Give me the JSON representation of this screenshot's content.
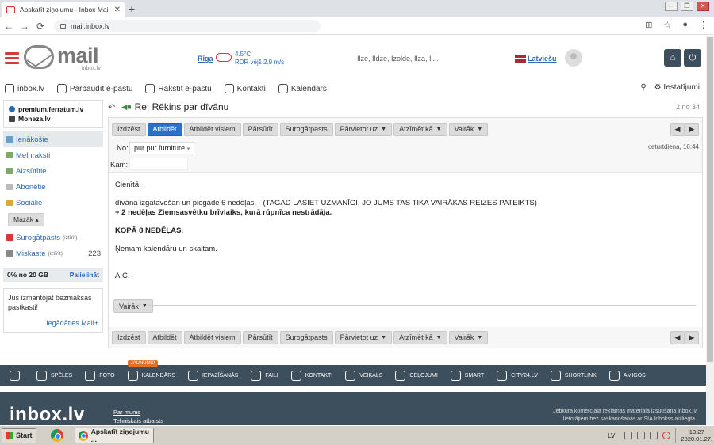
{
  "browser": {
    "tab_title": "Apskatīt ziņojumu - Inbox Mail",
    "tab_close": "✕",
    "new_tab": "+",
    "url": "mail.inbox.lv",
    "win_controls": [
      "—",
      "❐",
      "✕"
    ],
    "nav_back": "←",
    "nav_forward": "→",
    "nav_reload": "⟳"
  },
  "header": {
    "logo_text": "mail",
    "logo_sub": "inbox.lv",
    "weather_city": "Rīga",
    "weather_temp": "4.5°C",
    "weather_wind": "RDR vējš 2.9 m/s",
    "namedays": "Ilze, Ildze, Izolde, Ilza, Il...",
    "language": "Latviešu"
  },
  "linkbar": {
    "items": [
      "inbox.lv",
      "Pārbaudīt e-pastu",
      "Rakstīt e-pastu",
      "Kontakti",
      "Kalendārs"
    ],
    "settings": "Iestatījumi"
  },
  "sidebar": {
    "services": [
      "premium.ferratum.lv",
      "Moneza.lv"
    ],
    "folders": [
      {
        "label": "Ienākošie",
        "active": true
      },
      {
        "label": "Melnraksti"
      },
      {
        "label": "Aizsūtītie"
      },
      {
        "label": "Abonētie"
      },
      {
        "label": "Sociālie"
      }
    ],
    "less": "Mazāk ▴",
    "spam": {
      "label": "Surogātpasts",
      "note": "(iztīrīt)"
    },
    "trash": {
      "label": "Miskaste",
      "note": "(iztīrīt)",
      "count": "223"
    },
    "quota": "0% no 20 GB",
    "upgrade": "Palielināt",
    "promo_text": "Jūs izmantojat bezmaksas pastkasti!",
    "promo_link": "Iegādāties Mail+"
  },
  "message": {
    "subject": "Re: Rēķins par dīvānu",
    "counter": "2 no 34",
    "actions": [
      "Izdzēst",
      "Atbildēt",
      "Atbildēt visiem",
      "Pārsūtīt",
      "Surogātpasts",
      "Pārvietot uz",
      "Atzīmēt kā",
      "Vairāk"
    ],
    "actions_bottom": [
      "Izdzēst",
      "Atbildēt",
      "Atbildēt visiem",
      "Pārsūtīt",
      "Surogātpasts",
      "Pārvietot uz",
      "Atzīmēt kā",
      "Vairāk"
    ],
    "from_label": "No:",
    "from": "pur pur furniture",
    "date": "ceturtdiena, 16:44",
    "to_label": "Kam:",
    "greeting": "Cienītā,",
    "line1": "dīvāna izgatavošan un piegāde 6 nedēļas, - (TAGAD LASIET UZMANĪGI, JO JUMS TAS TIKA VAIRĀKAS REIZES PATEIKTS)",
    "line2": "+ 2 nedēļas Ziemsasvētku brīvlaiks, kurā rūpnīca nestrādāja.",
    "line3": "KOPĀ 8 NEDĒĻAS.",
    "line4": "Ņemam kalendāru un skaitam.",
    "sign": "A.C.",
    "more": "Vairāk"
  },
  "bottom_nav": {
    "badge": "JAUNUMS!",
    "items": [
      "SPĒLES",
      "FOTO",
      "KALENDĀRS",
      "IEPAZĪŠANĀS",
      "FAILI",
      "KONTAKTI",
      "VEIKALS",
      "CEĻOJUMI",
      "SMART",
      "CITY24.LV",
      "SHORTLINK",
      "AMIGOS"
    ]
  },
  "footer": {
    "logo": "inbox.lv",
    "links": [
      "Par mums",
      "Tehniskais atbalsts"
    ],
    "note1": "Jebkura komerciāla reklāmas materiāla izsūtīšana inbox.lv",
    "note2": "lietotājiem bez saskaņošanas ar SIA Inbokss aizliegta."
  },
  "taskbar": {
    "start": "Start",
    "item": "Apskatīt ziņojumu ...",
    "lang": "LV",
    "time": "13:27",
    "date": "2020.01.27."
  }
}
